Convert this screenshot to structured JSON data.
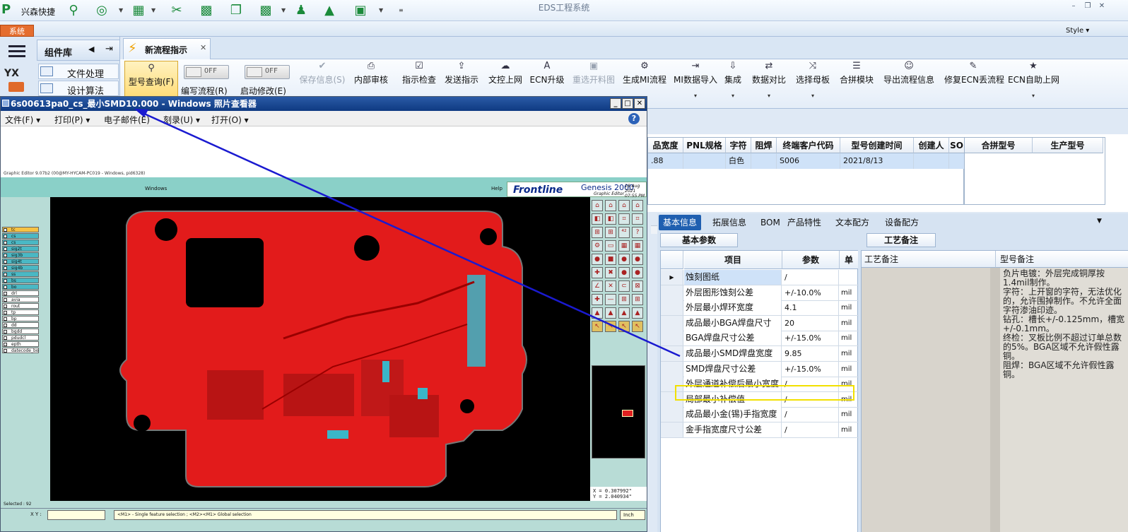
{
  "app": {
    "name": "兴森快捷",
    "title": "EDS工程系统",
    "system_tab": "系统",
    "style_label": "Style",
    "colors": {
      "accent": "#1f5fb0",
      "highlight": "#f2e000",
      "arrow": "#1a1ad0",
      "board": "#e21b1b"
    }
  },
  "nav": {
    "component_library": "组件库",
    "items": [
      "文件处理",
      "设计算法"
    ]
  },
  "doc_tab": {
    "label": "新流程指示"
  },
  "ribbon": {
    "query": "型号查询(F)",
    "toggles": [
      {
        "state": "OFF",
        "label": "编写流程(R)"
      },
      {
        "state": "OFF",
        "label": "启动修改(E)"
      }
    ],
    "buttons": [
      {
        "label": "保存信息(S)",
        "icon": "check-icon",
        "disabled": true
      },
      {
        "label": "内部审核",
        "icon": "printer-icon"
      },
      {
        "label": "指示检查",
        "icon": "checkbox-icon"
      },
      {
        "label": "发送指示",
        "icon": "upload-icon"
      },
      {
        "label": "文控上网",
        "icon": "cloud-upload-icon"
      },
      {
        "label": "ECN升级",
        "icon": "a-icon"
      },
      {
        "label": "重选开料图",
        "icon": "image-icon",
        "disabled": true
      },
      {
        "label": "生成MI流程",
        "icon": "gears-icon"
      },
      {
        "label": "MI数据导入",
        "icon": "import-icon",
        "drop": true
      },
      {
        "label": "集成",
        "icon": "download-icon",
        "drop": true
      },
      {
        "label": "数据对比",
        "icon": "compare-icon",
        "drop": true
      },
      {
        "label": "选择母板",
        "icon": "shuffle-icon",
        "drop": true
      },
      {
        "label": "合拼模块",
        "icon": "list-icon"
      },
      {
        "label": "导出流程信息",
        "icon": "smile-icon"
      },
      {
        "label": "修复ECN丢流程",
        "icon": "wrench-icon"
      },
      {
        "label": "ECN自助上网",
        "icon": "star-icon",
        "drop": true
      }
    ]
  },
  "grid1": {
    "headers": [
      "品宽度",
      "PNL规格",
      "字符",
      "阻焊",
      "终端客户代码",
      "型号创建时间",
      "创建人",
      "SO"
    ],
    "row": [
      ".88",
      "",
      "白色",
      "",
      "S006",
      "2021/8/13",
      "",
      ""
    ]
  },
  "grid2": {
    "headers": [
      "合拼型号",
      "生产型号"
    ]
  },
  "info_tabs": [
    "基本信息",
    "拓展信息",
    "BOM",
    "产品特性",
    "文本配方",
    "设备配方"
  ],
  "basic_params": {
    "tab": "基本参数",
    "headers": [
      "项目",
      "参数",
      "单"
    ],
    "rows": [
      {
        "name": "蚀刻图纸",
        "value": "/",
        "unit": ""
      },
      {
        "name": "外层图形蚀刻公差",
        "value": "+/-10.0%",
        "unit": "mil"
      },
      {
        "name": "外层最小焊环宽度",
        "value": "4.1",
        "unit": "mil"
      },
      {
        "name": "成品最小BGA焊盘尺寸",
        "value": "20",
        "unit": "mil"
      },
      {
        "name": "BGA焊盘尺寸公差",
        "value": "+/-15.0%",
        "unit": "mil"
      },
      {
        "name": "成品最小SMD焊盘宽度",
        "value": "9.85",
        "unit": "mil"
      },
      {
        "name": "SMD焊盘尺寸公差",
        "value": "+/-15.0%",
        "unit": "mil"
      },
      {
        "name": "外层通道补偿后最小宽度",
        "value": "/",
        "unit": "mil"
      },
      {
        "name": "局部最小补偿值",
        "value": "/",
        "unit": "mil"
      },
      {
        "name": "成品最小金(锡)手指宽度",
        "value": "/",
        "unit": "mil"
      },
      {
        "name": "金手指宽度尺寸公差",
        "value": "/",
        "unit": "mil"
      }
    ]
  },
  "process_notes": {
    "tab": "工艺备注",
    "col1": "工艺备注",
    "col2": "型号备注",
    "text": "负片电镀：外层完成铜厚按1.4mil制作。\n字符：上开窗的字符，无法优化的，允许围掉制作。不允许全面字符渗油印迹。\n钻孔：槽长+/-0.125mm，槽宽+/-0.1mm。\n终检：叉板比例不超过订单总数的5%。BGA区域不允许假性露铜。\n阻焊：BGA区域不允许假性露铜。"
  },
  "viewer": {
    "title": "6s00613pa0_cs_最小SMD10.000 - Windows 照片查看器",
    "menu": [
      "文件(F) ▾",
      "打印(P) ▾",
      "电子邮件(E)",
      "刻录(U) ▾",
      "打开(O) ▾"
    ]
  },
  "genesis": {
    "titlebar": "Graphic Editor 9.07b2 (00@MY-HYCAM-PC019 - Windows, pid6328)",
    "window_menu": "Windows",
    "help": "Help",
    "brand": "Frontline",
    "product": "Genesis 2000",
    "subtitle": "Graphic Editor",
    "date": "18 Aug 2021",
    "time": "07:55 PM",
    "layers": [
      "tc",
      "cs",
      "cs",
      "sig2t",
      "sig3b",
      "sig4t",
      "sig4b",
      "ss",
      "bs",
      "bo",
      "drl",
      "avia",
      "rout",
      "tp",
      "bp",
      "dd",
      "bgdd",
      "pdudcl",
      "epth",
      "datecode_bo"
    ],
    "coord_x": "X = 0.307992\"",
    "coord_y": "Y = 2.040934\"",
    "status": "Selected : 92",
    "xy_label": "X Y :",
    "message": "<M1> - Single feature selection ; <M2><M1> Global selection",
    "units": "Inch"
  }
}
